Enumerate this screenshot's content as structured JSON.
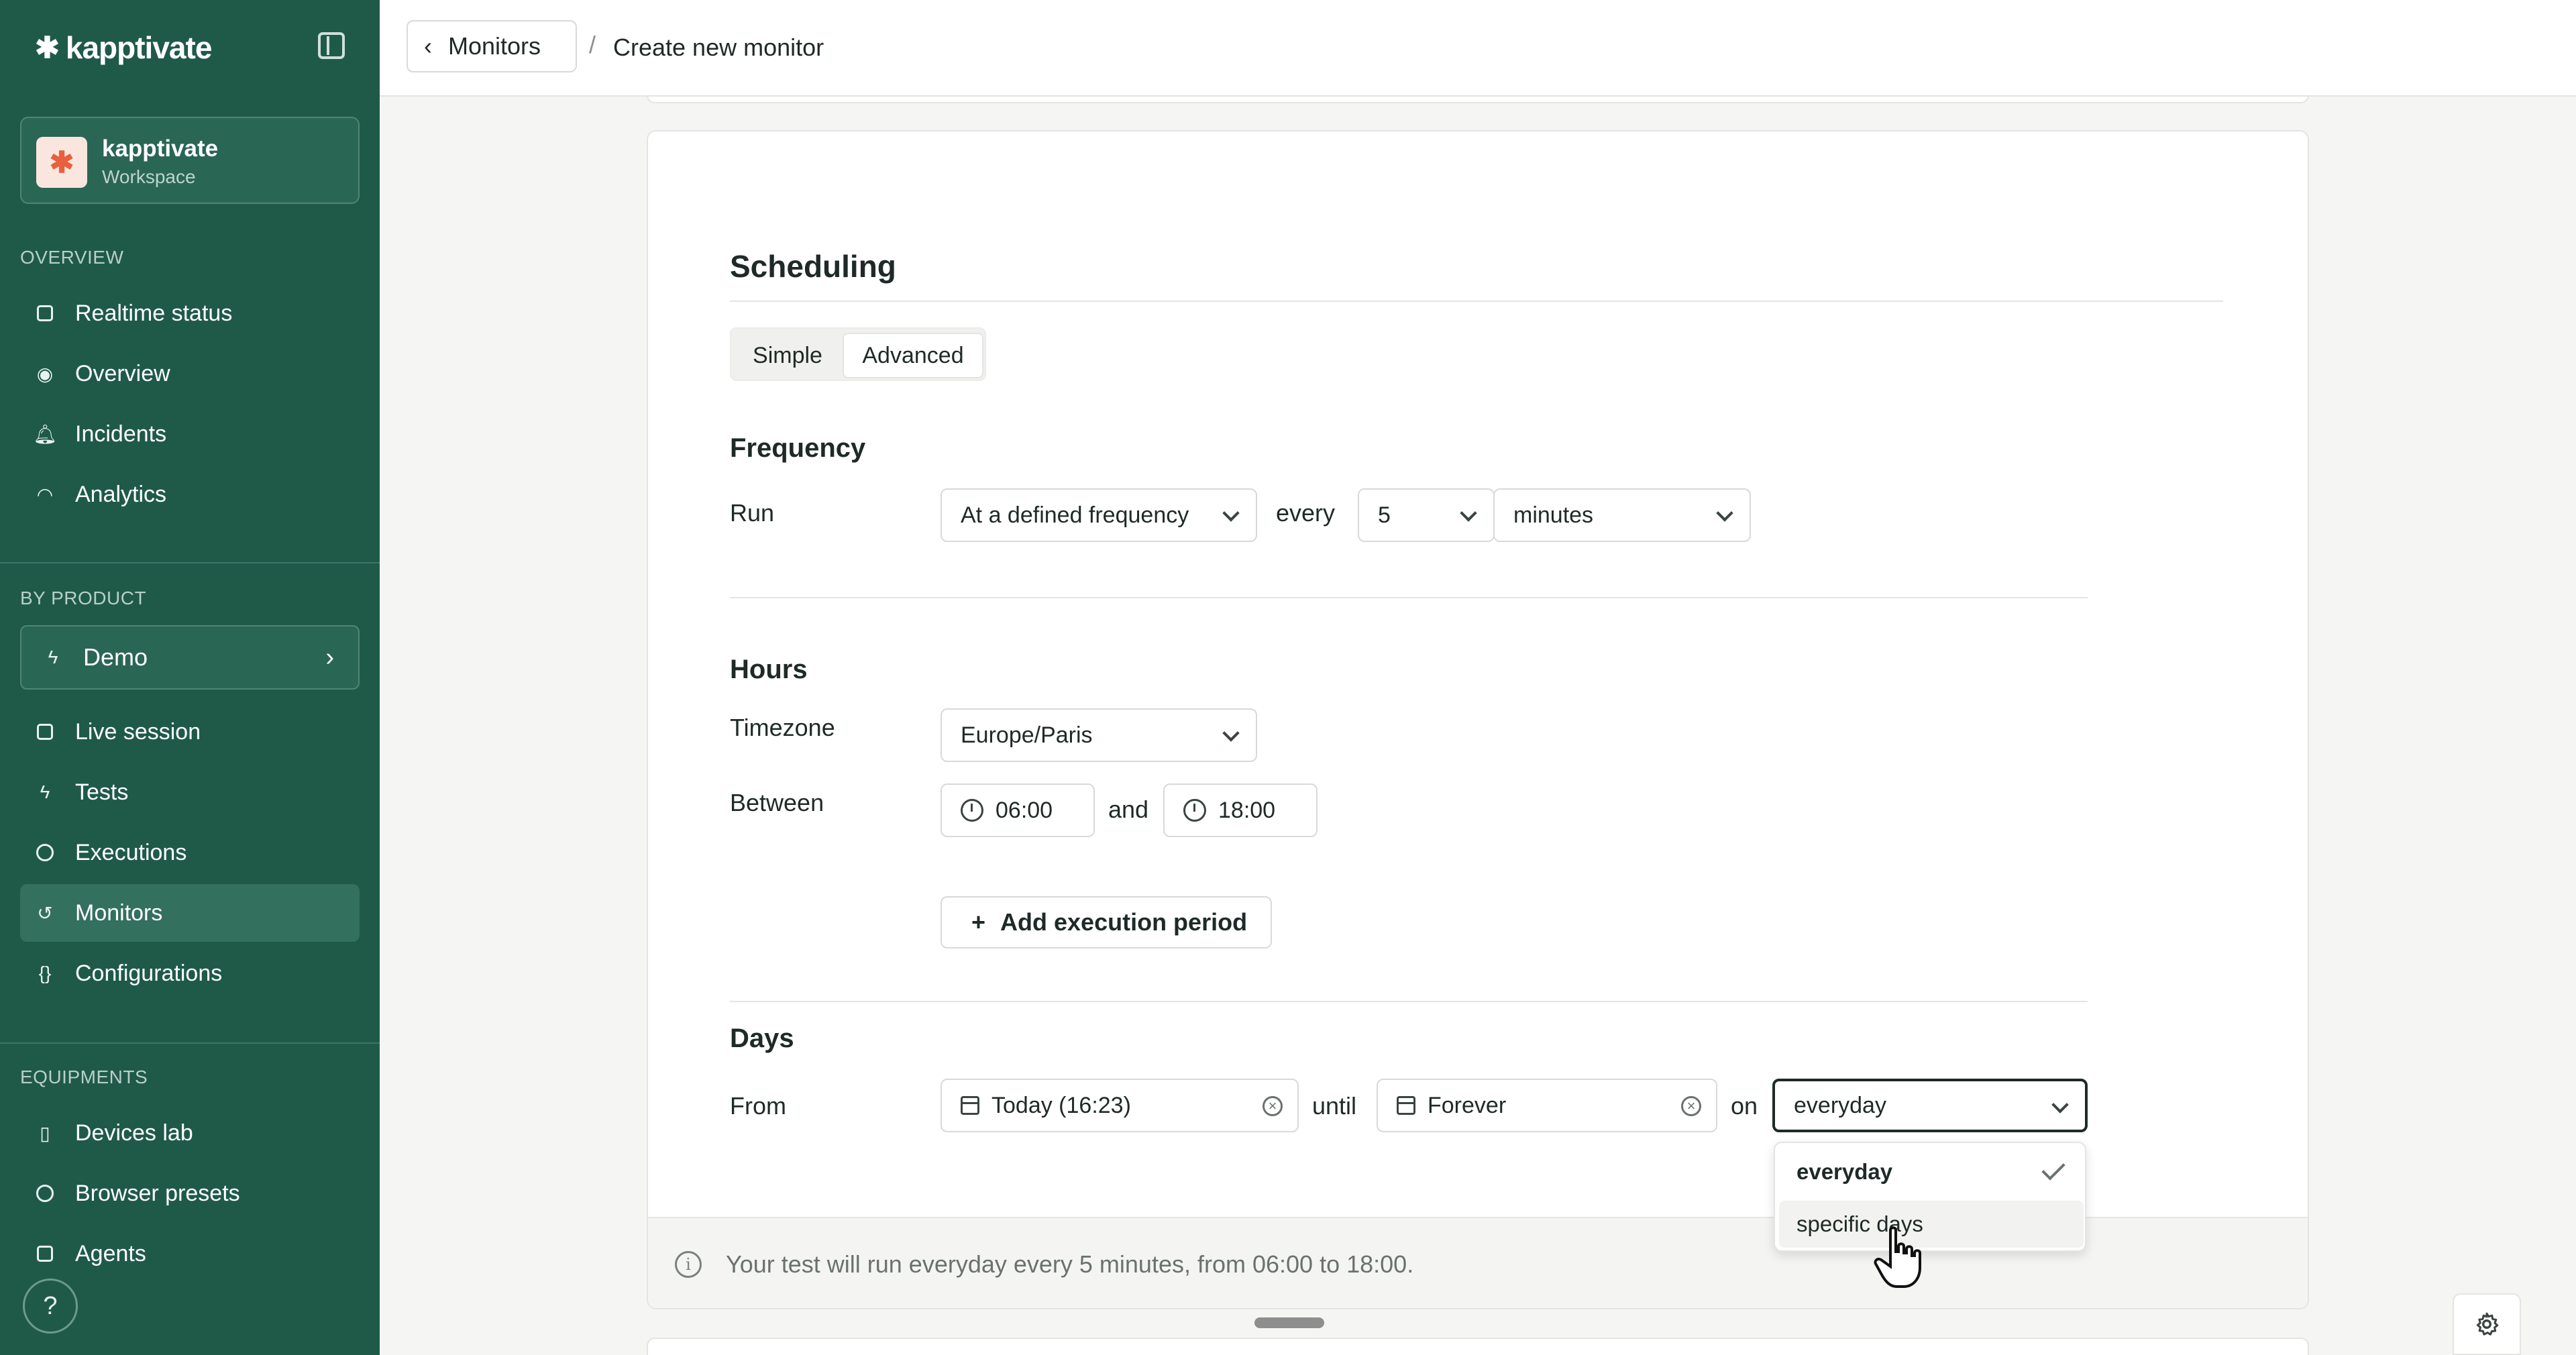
{
  "sidebar": {
    "brand": "kapptivate",
    "workspace": {
      "name": "kapptivate",
      "sub": "Workspace",
      "logo_glyph": "✱"
    },
    "overview_title": "OVERVIEW",
    "overview_items": [
      {
        "label": "Realtime status",
        "icon": "monitor-icon"
      },
      {
        "label": "Overview",
        "icon": "eye-icon"
      },
      {
        "label": "Incidents",
        "icon": "bell-icon"
      },
      {
        "label": "Analytics",
        "icon": "gauge-icon"
      }
    ],
    "product_title": "BY PRODUCT",
    "product": {
      "label": "Demo",
      "icon": "bolt-icon"
    },
    "product_items": [
      {
        "label": "Live session",
        "icon": "screen-icon"
      },
      {
        "label": "Tests",
        "icon": "bolt-icon"
      },
      {
        "label": "Executions",
        "icon": "check-circle-icon"
      },
      {
        "label": "Monitors",
        "icon": "history-icon",
        "active": true
      },
      {
        "label": "Configurations",
        "icon": "braces-icon"
      }
    ],
    "equipments_title": "EQUIPMENTS",
    "equipment_items": [
      {
        "label": "Devices lab",
        "icon": "phone-icon"
      },
      {
        "label": "Browser presets",
        "icon": "chrome-icon"
      },
      {
        "label": "Agents",
        "icon": "robot-icon"
      }
    ],
    "help": "?"
  },
  "topbar": {
    "back_label": "Monitors",
    "separator": "/",
    "current": "Create new monitor"
  },
  "scheduling": {
    "title": "Scheduling",
    "mode_simple": "Simple",
    "mode_advanced": "Advanced",
    "frequency": {
      "title": "Frequency",
      "run_label": "Run",
      "run_value": "At a defined frequency",
      "every_label": "every",
      "every_value": "5",
      "unit_value": "minutes"
    },
    "hours": {
      "title": "Hours",
      "timezone_label": "Timezone",
      "timezone_value": "Europe/Paris",
      "between_label": "Between",
      "start": "06:00",
      "and_label": "and",
      "end": "18:00",
      "add_period": "Add execution period"
    },
    "days": {
      "title": "Days",
      "from_label": "From",
      "from_value": "Today (16:23)",
      "until_label": "until",
      "until_value": "Forever",
      "on_label": "on",
      "on_value": "everyday",
      "options": [
        "everyday",
        "specific days"
      ]
    },
    "summary": "Your test will run everyday every 5 minutes, from 06:00 to 18:00."
  },
  "colors": {
    "sidebar_bg": "#1f5a49",
    "accent": "#e8603c"
  }
}
